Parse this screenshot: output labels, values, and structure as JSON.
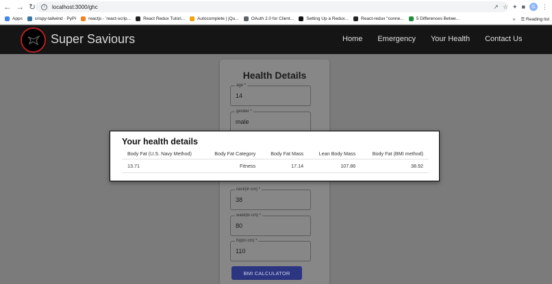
{
  "browser": {
    "url": "localhost:3000/ghc",
    "avatar_letter": "G",
    "bookmarks": [
      {
        "label": "Apps",
        "color": "#4285f4"
      },
      {
        "label": "crispy-tailwind · PyPI",
        "color": "#3775a9"
      },
      {
        "label": "reactjs - 'react-scrip...",
        "color": "#f48024"
      },
      {
        "label": "React Redux Tutori...",
        "color": "#222222"
      },
      {
        "label": "Autocomplete | jQu...",
        "color": "#f0a30a"
      },
      {
        "label": "OAuth 2.0 for Client...",
        "color": "#5f6368"
      },
      {
        "label": "Setting Up a Redux...",
        "color": "#111111"
      },
      {
        "label": "React-redux \"conne...",
        "color": "#222222"
      },
      {
        "label": "5 Differences Betwe...",
        "color": "#1e8e3e"
      }
    ],
    "reading_list": "Reading list"
  },
  "app": {
    "brand": "Super Saviours",
    "nav": [
      "Home",
      "Emergency",
      "Your Health",
      "Contact Us"
    ]
  },
  "form": {
    "title": "Health Details",
    "fields": [
      {
        "label": "age *",
        "value": "14"
      },
      {
        "label": "gender *",
        "value": "male"
      },
      {
        "label": "neck(in cm) *",
        "value": "38"
      },
      {
        "label": "waist(in cm) *",
        "value": "80"
      },
      {
        "label": "hip(in cm) *",
        "value": "110"
      }
    ],
    "button": "BMI CALCULATOR"
  },
  "modal": {
    "title": "Your health details",
    "columns": [
      "Body Fat (U.S. Navy Method)",
      "Body Fat Category",
      "Body Fat Mass",
      "Lean Body Mass",
      "Body Fat (BMI method)"
    ],
    "row": [
      "13.71",
      "Fitness",
      "17.14",
      "107.86",
      "38.92"
    ]
  }
}
